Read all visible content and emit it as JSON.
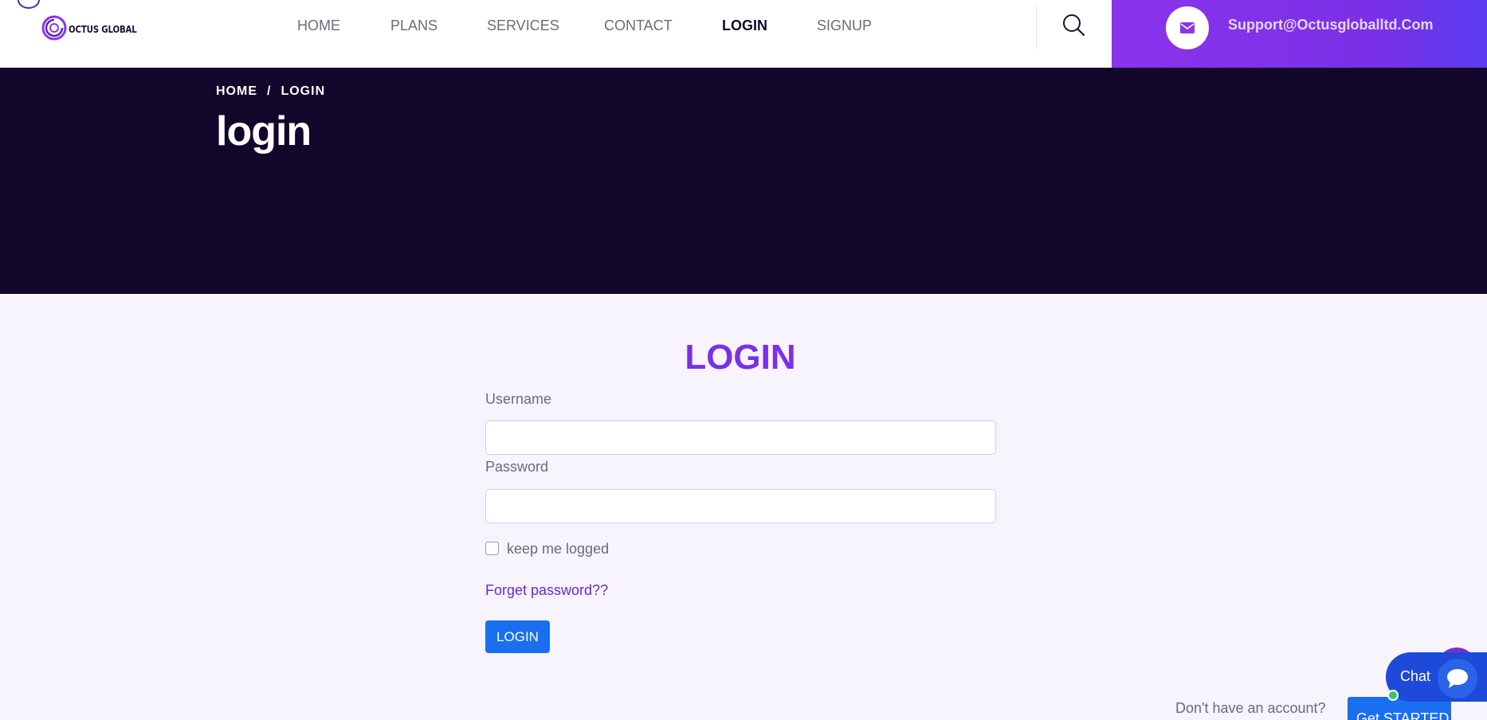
{
  "header": {
    "logo_text": "OCTUS GLOBAL",
    "nav": [
      {
        "label": "HOME",
        "active": false
      },
      {
        "label": "PLANS",
        "active": false
      },
      {
        "label": "SERVICES",
        "active": false
      },
      {
        "label": "CONTACT",
        "active": false
      },
      {
        "label": "LOGIN",
        "active": true
      },
      {
        "label": "SIGNUP",
        "active": false
      }
    ],
    "search_icon": "search-icon",
    "support": {
      "icon": "envelope-icon",
      "email": "Support@Octusgloballtd.Com"
    }
  },
  "banner": {
    "breadcrumb": {
      "home": "HOME",
      "separator": "/",
      "current": "LOGIN"
    },
    "title": "login"
  },
  "form": {
    "title": "LOGIN",
    "username_label": "Username",
    "username_value": "",
    "password_label": "Password",
    "password_value": "",
    "remember_label": "keep me logged",
    "remember_checked": false,
    "forget_link": "Forget password??",
    "submit_label": "LOGIN"
  },
  "footer_prompt": {
    "text": "Don't have an account?",
    "button_label": "Get STARTED"
  },
  "chat": {
    "label": "Chat",
    "icon": "chat-bubble-icon",
    "status": "online"
  },
  "colors": {
    "accent_purple": "#7a30e6",
    "banner_bg": "#12062b",
    "button_blue": "#1a6ff0",
    "page_bg": "#f7f4fd"
  }
}
